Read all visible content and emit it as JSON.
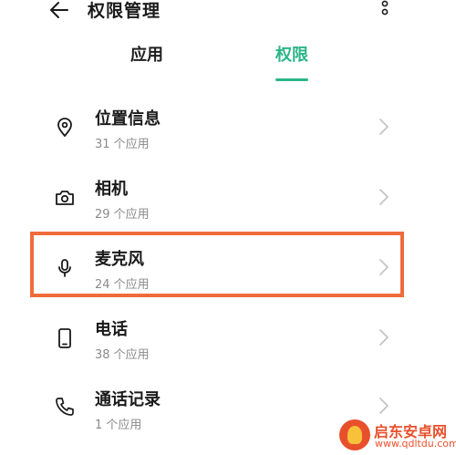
{
  "header": {
    "title": "权限管理",
    "back_icon": "arrow-left-icon",
    "more_icon": "more-vertical-icon"
  },
  "tabs": [
    {
      "label": "应用",
      "active": false
    },
    {
      "label": "权限",
      "active": true
    }
  ],
  "colors": {
    "accent": "#2bb587",
    "highlight": "#ee6c3c",
    "watermark": "#e8502c"
  },
  "permissions": [
    {
      "title": "位置信息",
      "subtitle": "31 个应用",
      "icon": "location-icon"
    },
    {
      "title": "相机",
      "subtitle": "29 个应用",
      "icon": "camera-icon"
    },
    {
      "title": "麦克风",
      "subtitle": "24 个应用",
      "icon": "microphone-icon"
    },
    {
      "title": "电话",
      "subtitle": "38 个应用",
      "icon": "phone-icon"
    },
    {
      "title": "通话记录",
      "subtitle": "1 个应用",
      "icon": "call-log-icon"
    }
  ],
  "watermark": {
    "name": "启东安卓网",
    "url": "www.qdltdu.com"
  }
}
